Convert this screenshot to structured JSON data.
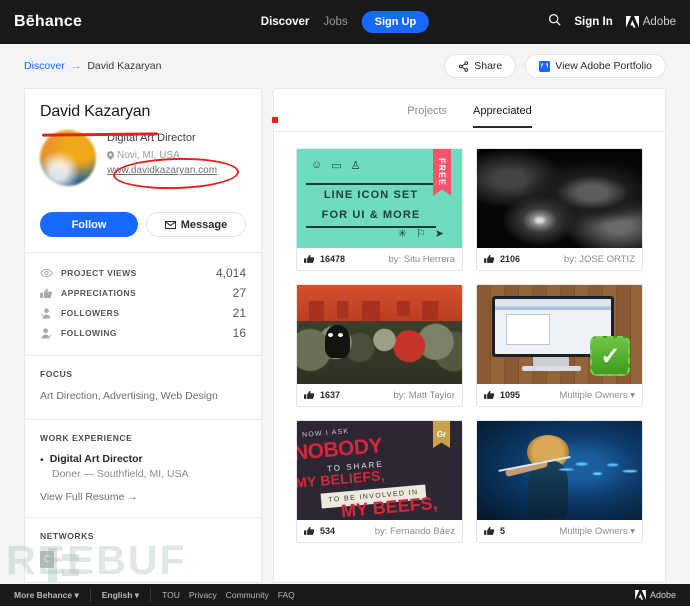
{
  "nav": {
    "brand": "Bēhance",
    "discover": "Discover",
    "jobs": "Jobs",
    "signup": "Sign Up",
    "signin": "Sign In",
    "adobe": "Adobe",
    "search_icon": "search-icon",
    "accent": "#1769ff"
  },
  "breadcrumb": {
    "root": "Discover",
    "arrow": "→",
    "current": "David Kazaryan",
    "share": "Share",
    "portfolio": "View Adobe Portfolio"
  },
  "profile": {
    "name": "David Kazaryan",
    "role": "Digital Art Director",
    "location": "Novi, MI, USA",
    "website": "www.davidkazaryan.com",
    "follow": "Follow",
    "message": "Message",
    "stats": [
      {
        "label": "PROJECT VIEWS",
        "value": "4,014",
        "icon": "eye-icon"
      },
      {
        "label": "APPRECIATIONS",
        "value": "27",
        "icon": "thumb-up-icon"
      },
      {
        "label": "FOLLOWERS",
        "value": "21",
        "icon": "follower-icon"
      },
      {
        "label": "FOLLOWING",
        "value": "16",
        "icon": "following-icon"
      }
    ],
    "focus_title": "FOCUS",
    "focus_body": "Art Direction, Advertising, Web Design",
    "work_title": "WORK EXPERIENCE",
    "job_title": "Digital Art Director",
    "job_sub": "Doner — Southfield, MI, USA",
    "resume": "View Full Resume →",
    "networks_title": "NETWORKS",
    "network_icon_label": "C"
  },
  "tabs": [
    {
      "label": "Projects",
      "active": false
    },
    {
      "label": "Appreciated",
      "active": true
    }
  ],
  "projects": [
    {
      "likes": "16478",
      "by": "by: Situ Herrera",
      "title_line1": "LINE ICON SET",
      "title_line2": "FOR UI & MORE",
      "ribbon": "FREE"
    },
    {
      "likes": "2106",
      "by": "by: JOSE ORTIZ"
    },
    {
      "likes": "1637",
      "by": "by: Matt Taylor"
    },
    {
      "likes": "1095",
      "by": "Multiple Owners ▾"
    },
    {
      "likes": "534",
      "by": "by: Fernando Báez",
      "poster_l1": "NOW I ASK",
      "poster_l2": "NOBODY",
      "poster_l3": "TO SHARE",
      "poster_l4": "MY BELIEFS,",
      "poster_ribbon": "TO BE INVOLVED IN",
      "poster_l5": "MY BEEFS,",
      "ribbon": "Gr"
    },
    {
      "likes": "5",
      "by": "Multiple Owners ▾"
    }
  ],
  "watermark": {
    "text": "REEBUF"
  },
  "footer": {
    "more": "More Behance ▾",
    "language": "English ▾",
    "links": [
      "TOU",
      "Privacy",
      "Community",
      "FAQ"
    ],
    "adobe": "Adobe"
  }
}
